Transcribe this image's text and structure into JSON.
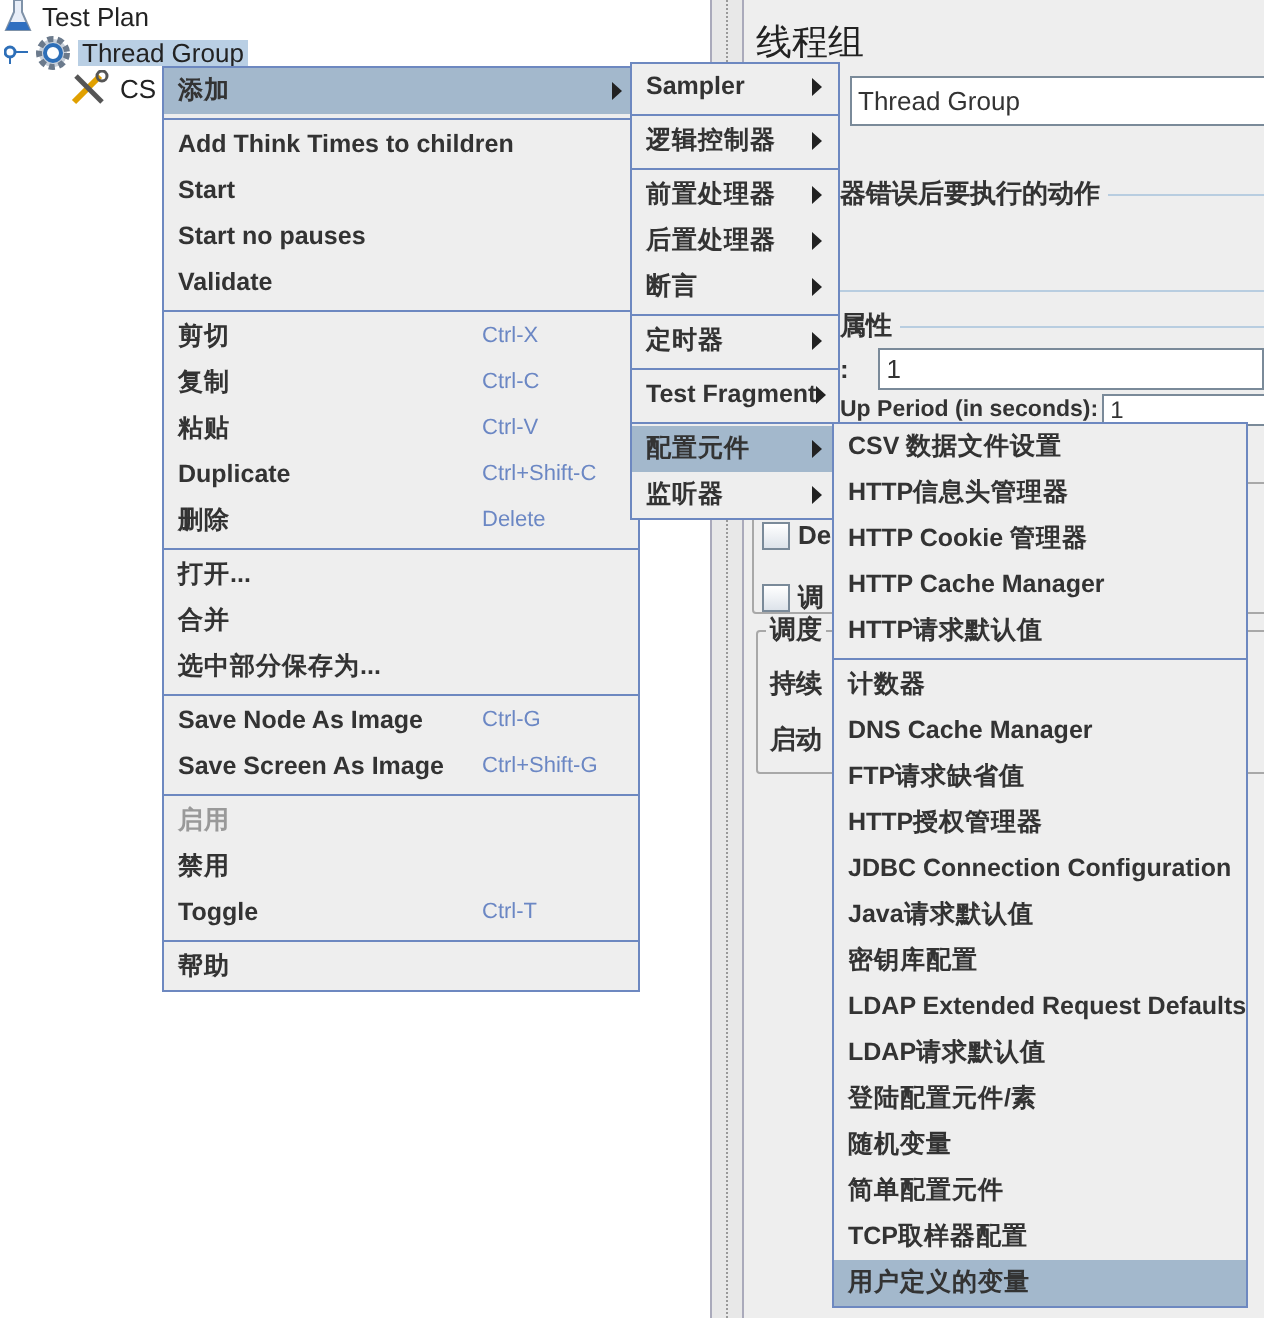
{
  "tree": [
    {
      "label": "Test Plan",
      "kind": "plan",
      "selected": false,
      "children": [
        {
          "label": "Thread Group",
          "kind": "thread_group",
          "selected": true,
          "children": [
            {
              "label": "CS",
              "kind": "config",
              "selected": false
            }
          ]
        }
      ]
    }
  ],
  "form": {
    "title": "线程组",
    "name_value": "Thread Group",
    "error_action_legend": "器错误后要执行的动作",
    "thread_props_legend": "属性",
    "threads_label": ":",
    "threads_value": "1",
    "ramp_label": "Up Period (in seconds):",
    "ramp_value": "1",
    "checkboxes": [
      {
        "label": "De",
        "checked": false
      },
      {
        "label": "调",
        "checked": false
      }
    ],
    "scheduler_legend": "调度",
    "scheduler_labels": [
      "持续",
      "启动"
    ]
  },
  "context_menu": [
    {
      "kind": "item",
      "label": "添加",
      "submenu": true,
      "selected": true,
      "disabled": false
    },
    {
      "kind": "separator"
    },
    {
      "kind": "item",
      "label": "Add Think Times to children",
      "submenu": false,
      "selected": false,
      "disabled": false
    },
    {
      "kind": "item",
      "label": "Start",
      "submenu": false,
      "selected": false,
      "disabled": false
    },
    {
      "kind": "item",
      "label": "Start no pauses",
      "submenu": false,
      "selected": false,
      "disabled": false
    },
    {
      "kind": "item",
      "label": "Validate",
      "submenu": false,
      "selected": false,
      "disabled": false
    },
    {
      "kind": "separator"
    },
    {
      "kind": "item",
      "label": "剪切",
      "shortcut": "Ctrl-X",
      "submenu": false,
      "selected": false,
      "disabled": false
    },
    {
      "kind": "item",
      "label": "复制",
      "shortcut": "Ctrl-C",
      "submenu": false,
      "selected": false,
      "disabled": false
    },
    {
      "kind": "item",
      "label": "粘贴",
      "shortcut": "Ctrl-V",
      "submenu": false,
      "selected": false,
      "disabled": false
    },
    {
      "kind": "item",
      "label": "Duplicate",
      "shortcut": "Ctrl+Shift-C",
      "submenu": false,
      "selected": false,
      "disabled": false
    },
    {
      "kind": "item",
      "label": "删除",
      "shortcut": "Delete",
      "submenu": false,
      "selected": false,
      "disabled": false
    },
    {
      "kind": "separator"
    },
    {
      "kind": "item",
      "label": "打开...",
      "submenu": false,
      "selected": false,
      "disabled": false
    },
    {
      "kind": "item",
      "label": "合并",
      "submenu": false,
      "selected": false,
      "disabled": false
    },
    {
      "kind": "item",
      "label": "选中部分保存为...",
      "submenu": false,
      "selected": false,
      "disabled": false
    },
    {
      "kind": "separator"
    },
    {
      "kind": "item",
      "label": "Save Node As Image",
      "shortcut": "Ctrl-G",
      "submenu": false,
      "selected": false,
      "disabled": false
    },
    {
      "kind": "item",
      "label": "Save Screen As Image",
      "shortcut": "Ctrl+Shift-G",
      "submenu": false,
      "selected": false,
      "disabled": false
    },
    {
      "kind": "separator"
    },
    {
      "kind": "item",
      "label": "启用",
      "submenu": false,
      "selected": false,
      "disabled": true
    },
    {
      "kind": "item",
      "label": "禁用",
      "submenu": false,
      "selected": false,
      "disabled": false
    },
    {
      "kind": "item",
      "label": "Toggle",
      "shortcut": "Ctrl-T",
      "submenu": false,
      "selected": false,
      "disabled": false
    },
    {
      "kind": "separator"
    },
    {
      "kind": "item",
      "label": "帮助",
      "submenu": false,
      "selected": false,
      "disabled": false
    }
  ],
  "add_submenu": [
    {
      "kind": "item",
      "label": "Sampler",
      "submenu": true,
      "selected": false
    },
    {
      "kind": "separator"
    },
    {
      "kind": "item",
      "label": "逻辑控制器",
      "submenu": true,
      "selected": false
    },
    {
      "kind": "separator"
    },
    {
      "kind": "item",
      "label": "前置处理器",
      "submenu": true,
      "selected": false
    },
    {
      "kind": "item",
      "label": "后置处理器",
      "submenu": true,
      "selected": false
    },
    {
      "kind": "item",
      "label": "断言",
      "submenu": true,
      "selected": false
    },
    {
      "kind": "separator"
    },
    {
      "kind": "item",
      "label": "定时器",
      "submenu": true,
      "selected": false
    },
    {
      "kind": "separator"
    },
    {
      "kind": "item",
      "label": "Test Fragment",
      "submenu": true,
      "selected": false
    },
    {
      "kind": "separator"
    },
    {
      "kind": "item",
      "label": "配置元件",
      "submenu": true,
      "selected": true
    },
    {
      "kind": "item",
      "label": "监听器",
      "submenu": true,
      "selected": false
    }
  ],
  "config_submenu": [
    {
      "kind": "item",
      "label": "CSV 数据文件设置",
      "selected": false
    },
    {
      "kind": "item",
      "label": "HTTP信息头管理器",
      "selected": false
    },
    {
      "kind": "item",
      "label": "HTTP Cookie 管理器",
      "selected": false
    },
    {
      "kind": "item",
      "label": "HTTP Cache Manager",
      "selected": false
    },
    {
      "kind": "item",
      "label": "HTTP请求默认值",
      "selected": false
    },
    {
      "kind": "separator"
    },
    {
      "kind": "item",
      "label": "计数器",
      "selected": false
    },
    {
      "kind": "item",
      "label": "DNS Cache Manager",
      "selected": false
    },
    {
      "kind": "item",
      "label": "FTP请求缺省值",
      "selected": false
    },
    {
      "kind": "item",
      "label": "HTTP授权管理器",
      "selected": false
    },
    {
      "kind": "item",
      "label": "JDBC Connection Configuration",
      "selected": false
    },
    {
      "kind": "item",
      "label": "Java请求默认值",
      "selected": false
    },
    {
      "kind": "item",
      "label": "密钥库配置",
      "selected": false
    },
    {
      "kind": "item",
      "label": "LDAP Extended Request Defaults",
      "selected": false
    },
    {
      "kind": "item",
      "label": "LDAP请求默认值",
      "selected": false
    },
    {
      "kind": "item",
      "label": "登陆配置元件/素",
      "selected": false
    },
    {
      "kind": "item",
      "label": "随机变量",
      "selected": false
    },
    {
      "kind": "item",
      "label": "简单配置元件",
      "selected": false
    },
    {
      "kind": "item",
      "label": "TCP取样器配置",
      "selected": false
    },
    {
      "kind": "item",
      "label": "用户定义的变量",
      "selected": true
    }
  ]
}
